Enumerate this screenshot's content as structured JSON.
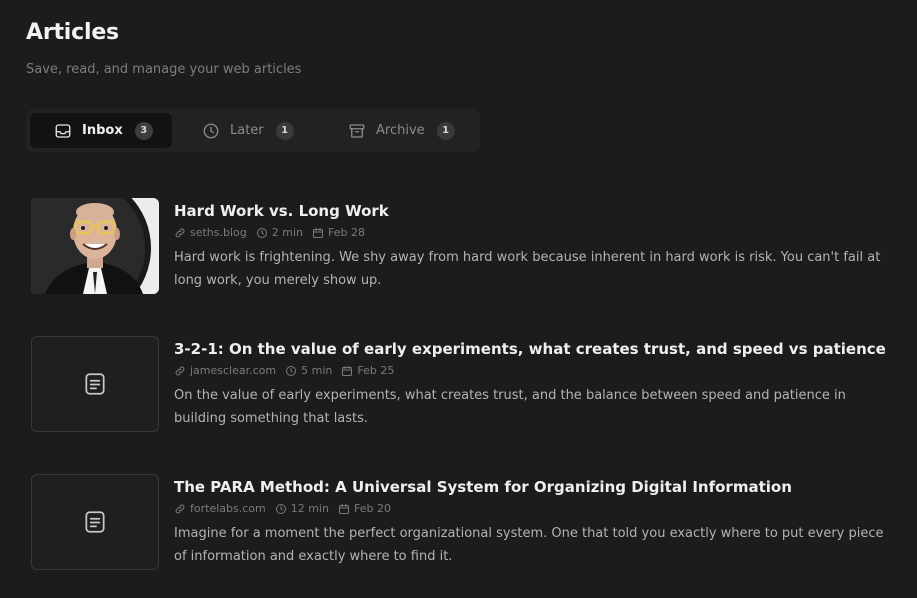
{
  "header": {
    "title": "Articles",
    "subtitle": "Save, read, and manage your web articles"
  },
  "tabs": [
    {
      "label": "Inbox",
      "count": "3",
      "icon": "inbox-icon",
      "active": true
    },
    {
      "label": "Later",
      "count": "1",
      "icon": "clock-icon",
      "active": false
    },
    {
      "label": "Archive",
      "count": "1",
      "icon": "archive-icon",
      "active": false
    }
  ],
  "articles": [
    {
      "title": "Hard Work vs. Long Work",
      "source": "seths.blog",
      "read_time": "2 min",
      "date": "Feb 28",
      "description": "Hard work is frightening. We shy away from hard work because inherent in hard work is risk. You can't fail at long work, you merely show up.",
      "thumbnail": "author-photo"
    },
    {
      "title": "3-2-1: On the value of early experiments, what creates trust, and speed vs patience",
      "source": "jamesclear.com",
      "read_time": "5 min",
      "date": "Feb 25",
      "description": "On the value of early experiments, what creates trust, and the balance between speed and patience in building something that lasts.",
      "thumbnail": "document-icon"
    },
    {
      "title": "The PARA Method: A Universal System for Organizing Digital Information",
      "source": "fortelabs.com",
      "read_time": "12 min",
      "date": "Feb 20",
      "description": "Imagine for a moment the perfect organizational system. One that told you exactly where to put every piece of information and exactly where to find it.",
      "thumbnail": "document-icon"
    }
  ],
  "colors": {
    "background": "#1c1c1c",
    "tab_bar": "#222222",
    "active_tab": "#121212",
    "muted_text": "#7a7a7a"
  }
}
